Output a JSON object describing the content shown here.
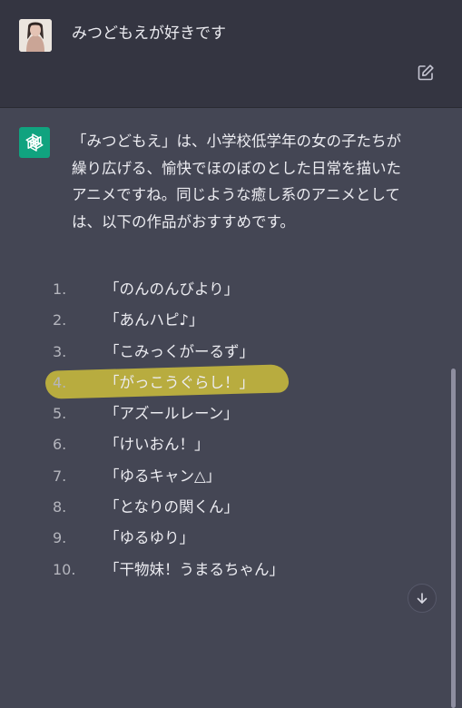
{
  "user_message": {
    "text": "みつどもえが好きです"
  },
  "assistant_message": {
    "paragraph_lines": [
      "「みつどもえ」は、小学校低学年の女の子たちが",
      "繰り広げる、愉快でほのぼのとした日常を描いた",
      "アニメですね。同じような癒し系のアニメとして",
      "は、以下の作品がおすすめです。"
    ],
    "recommendations": [
      {
        "num": "1.",
        "title": "「のんのんびより」"
      },
      {
        "num": "2.",
        "title": "「あんハピ♪」"
      },
      {
        "num": "3.",
        "title": "「こみっくがーるず」"
      },
      {
        "num": "4.",
        "title": "「がっこうぐらし！」",
        "highlighted": true
      },
      {
        "num": "5.",
        "title": "「アズールレーン」"
      },
      {
        "num": "6.",
        "title": "「けいおん！」"
      },
      {
        "num": "7.",
        "title": "「ゆるキャン△」"
      },
      {
        "num": "8.",
        "title": "「となりの関くん」"
      },
      {
        "num": "9.",
        "title": "「ゆるゆり」"
      },
      {
        "num": "10.",
        "title": "「干物妹！うまるちゃん」"
      }
    ]
  },
  "icons": {
    "edit": "edit-icon",
    "assistant_logo": "openai-logo-icon",
    "scroll_down": "arrow-down-icon"
  },
  "colors": {
    "user_bg": "#343541",
    "assistant_bg": "#444654",
    "logo_green": "#10a37f",
    "highlight_yellow": "#cdbe3c"
  }
}
